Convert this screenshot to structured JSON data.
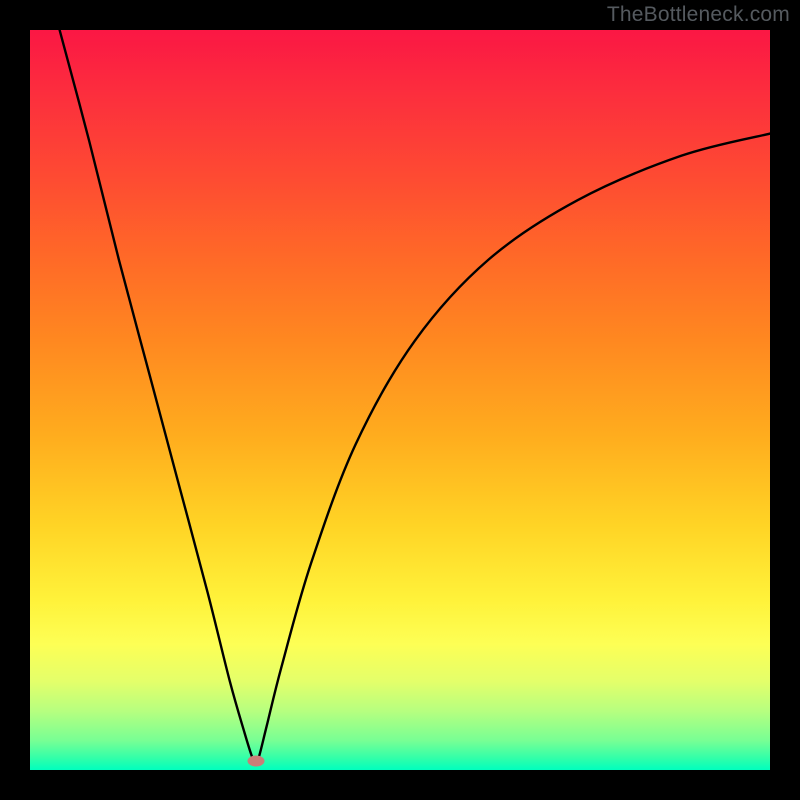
{
  "watermark": "TheBottleneck.com",
  "chart_data": {
    "type": "line",
    "title": "",
    "xlabel": "",
    "ylabel": "",
    "xlim": [
      0,
      100
    ],
    "ylim": [
      0,
      100
    ],
    "grid": false,
    "legend": false,
    "marker": {
      "x": 30.5,
      "y": 1.2
    },
    "series": [
      {
        "name": "curve",
        "x": [
          4,
          8,
          12,
          16,
          20,
          24,
          27,
          29,
          30,
          30.5,
          31,
          32,
          34,
          38,
          44,
          52,
          62,
          74,
          88,
          100
        ],
        "y": [
          100,
          85,
          69,
          54,
          39,
          24,
          12,
          5,
          1.8,
          0.8,
          2,
          6,
          14,
          28,
          44,
          58,
          69,
          77,
          83,
          86
        ]
      }
    ]
  }
}
